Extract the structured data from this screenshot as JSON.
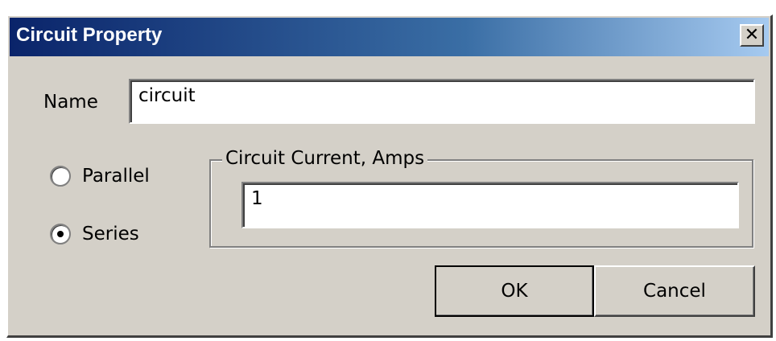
{
  "dialog": {
    "title": "Circuit Property",
    "close_label": "✕"
  },
  "name_field": {
    "label": "Name",
    "value": "circuit"
  },
  "connection": {
    "options": [
      {
        "label": "Parallel",
        "selected": false
      },
      {
        "label": "Series",
        "selected": true
      }
    ]
  },
  "current_group": {
    "legend": "Circuit Current, Amps",
    "value": "1"
  },
  "buttons": {
    "ok_label": "OK",
    "cancel_label": "Cancel"
  },
  "colors": {
    "title_start": "#0a246a",
    "title_end": "#a6caf0",
    "face": "#d4d0c8"
  }
}
